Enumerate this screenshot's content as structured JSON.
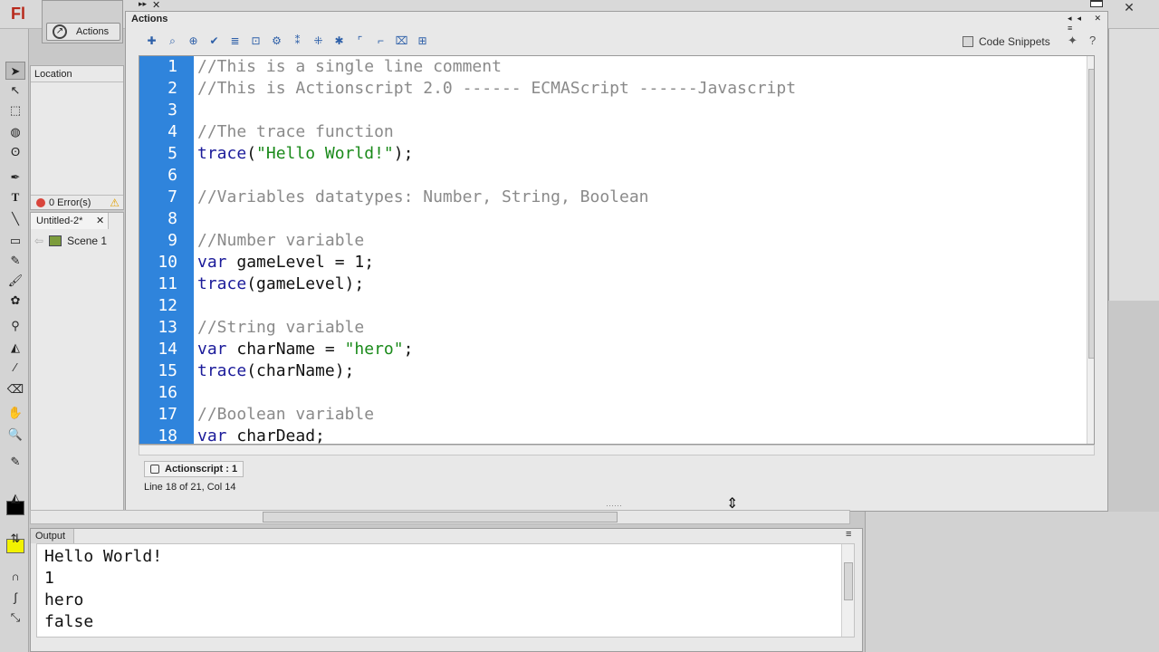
{
  "app": {
    "logo": "Fl"
  },
  "actions_mini": {
    "label": "Actions"
  },
  "location_panel": {
    "header": "Location",
    "errors": "0 Error(s)"
  },
  "scene_panel": {
    "doc_tab": "Untitled-2*",
    "scene": "Scene 1"
  },
  "actions_panel": {
    "title": "Actions",
    "code_snippets": "Code Snippets",
    "script_tab": "Actionscript : 1",
    "status": "Line 18 of 21, Col 14"
  },
  "code_lines": [
    {
      "n": "1",
      "segments": [
        {
          "t": "//This is a single line comment",
          "c": "cm"
        }
      ]
    },
    {
      "n": "2",
      "segments": [
        {
          "t": "//This is Actionscript 2.0 ------ ECMAScript ------Javascript",
          "c": "cm"
        }
      ]
    },
    {
      "n": "3",
      "segments": []
    },
    {
      "n": "4",
      "segments": [
        {
          "t": "//The trace function",
          "c": "cm"
        }
      ]
    },
    {
      "n": "5",
      "segments": [
        {
          "t": "trace",
          "c": "kw"
        },
        {
          "t": "(",
          "c": "pl"
        },
        {
          "t": "\"Hello World!\"",
          "c": "st"
        },
        {
          "t": ");",
          "c": "pl"
        }
      ]
    },
    {
      "n": "6",
      "segments": []
    },
    {
      "n": "7",
      "segments": [
        {
          "t": "//Variables datatypes: Number, String, Boolean",
          "c": "cm"
        }
      ]
    },
    {
      "n": "8",
      "segments": []
    },
    {
      "n": "9",
      "segments": [
        {
          "t": "//Number variable",
          "c": "cm"
        }
      ]
    },
    {
      "n": "10",
      "segments": [
        {
          "t": "var",
          "c": "kw"
        },
        {
          "t": " gameLevel = 1;",
          "c": "pl"
        }
      ]
    },
    {
      "n": "11",
      "segments": [
        {
          "t": "trace",
          "c": "kw"
        },
        {
          "t": "(gameLevel);",
          "c": "pl"
        }
      ]
    },
    {
      "n": "12",
      "segments": []
    },
    {
      "n": "13",
      "segments": [
        {
          "t": "//String variable",
          "c": "cm"
        }
      ]
    },
    {
      "n": "14",
      "segments": [
        {
          "t": "var",
          "c": "kw"
        },
        {
          "t": " charName = ",
          "c": "pl"
        },
        {
          "t": "\"hero\"",
          "c": "st"
        },
        {
          "t": ";",
          "c": "pl"
        }
      ]
    },
    {
      "n": "15",
      "segments": [
        {
          "t": "trace",
          "c": "kw"
        },
        {
          "t": "(charName);",
          "c": "pl"
        }
      ]
    },
    {
      "n": "16",
      "segments": []
    },
    {
      "n": "17",
      "segments": [
        {
          "t": "//Boolean variable",
          "c": "cm"
        }
      ]
    },
    {
      "n": "18",
      "segments": [
        {
          "t": "var",
          "c": "kw"
        },
        {
          "t": " charDead;",
          "c": "pl"
        }
      ]
    }
  ],
  "output": {
    "tab": "Output",
    "lines": [
      "Hello World!",
      "1",
      "hero",
      "false"
    ]
  },
  "colors": {
    "gutter": "#2f84dc",
    "keyword": "#1b1b9a",
    "string": "#1a8a1a",
    "comment": "#8a8a8a",
    "fill_swatch": "#f2f200",
    "stroke_swatch": "#000000"
  },
  "icons": {
    "tools": [
      "selection-tool-icon",
      "subselection-tool-icon",
      "free-transform-tool-icon",
      "3d-rotation-tool-icon",
      "lasso-tool-icon",
      "pen-tool-icon",
      "text-tool-icon",
      "line-tool-icon",
      "rectangle-tool-icon",
      "pencil-tool-icon",
      "brush-tool-icon",
      "deco-tool-icon",
      "bone-tool-icon",
      "paint-bucket-tool-icon",
      "eyedropper-tool-icon",
      "eraser-tool-icon",
      "hand-tool-icon",
      "zoom-tool-icon"
    ]
  }
}
